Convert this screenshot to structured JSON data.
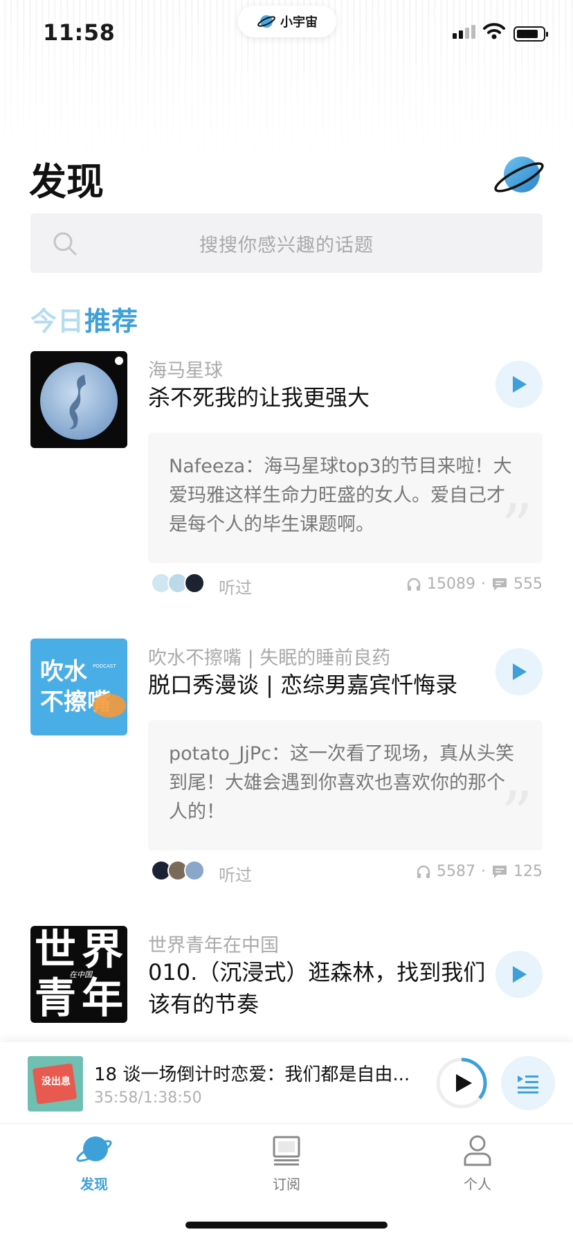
{
  "status_bar": {
    "time": "11:58",
    "app_name": "小宇宙"
  },
  "header": {
    "title": "发现"
  },
  "search": {
    "placeholder": "搜搜你感兴趣的话题"
  },
  "section": {
    "title_part1": "今日",
    "title_part2": "推荐"
  },
  "cards": [
    {
      "podcast": "海马星球",
      "title": "杀不死我的让我更强大",
      "comment": "Nafeeza：海马星球top3的节目来啦！大爱玛雅这样生命力旺盛的女人。爱自己才是每个人的毕生课题啊。",
      "listened": "听过",
      "plays": "15089",
      "sep": "·",
      "comments": "555"
    },
    {
      "podcast": "吹水不擦嘴 | 失眠的睡前良药",
      "title": "脱口秀漫谈 | 恋综男嘉宾忏悔录",
      "comment": "potato_JjPc：这一次看了现场，真从头笑到尾！大雄会遇到你喜欢也喜欢你的那个人的！",
      "listened": "听过",
      "plays": "5587",
      "sep": "·",
      "comments": "125",
      "cover_text_1": "吹水",
      "cover_text_2": "不擦嘴",
      "cover_badge": "PODCAST"
    },
    {
      "podcast": "世界青年在中国",
      "title": "010.（沉浸式）逛森林，找到我们该有的节奏",
      "cover_chars": [
        "世",
        "界",
        "青",
        "年"
      ],
      "cover_small": "在中国"
    }
  ],
  "player": {
    "title": "18 谈一场倒计时恋爱：我们都是自由...",
    "time": "35:58/1:38:50",
    "progress": 0.36,
    "cover_text": "没出息"
  },
  "tabs": [
    {
      "label": "发现",
      "active": true
    },
    {
      "label": "订阅",
      "active": false
    },
    {
      "label": "个人",
      "active": false
    }
  ],
  "colors": {
    "accent": "#3ea0d8",
    "accent_light": "#e8f3fb"
  }
}
